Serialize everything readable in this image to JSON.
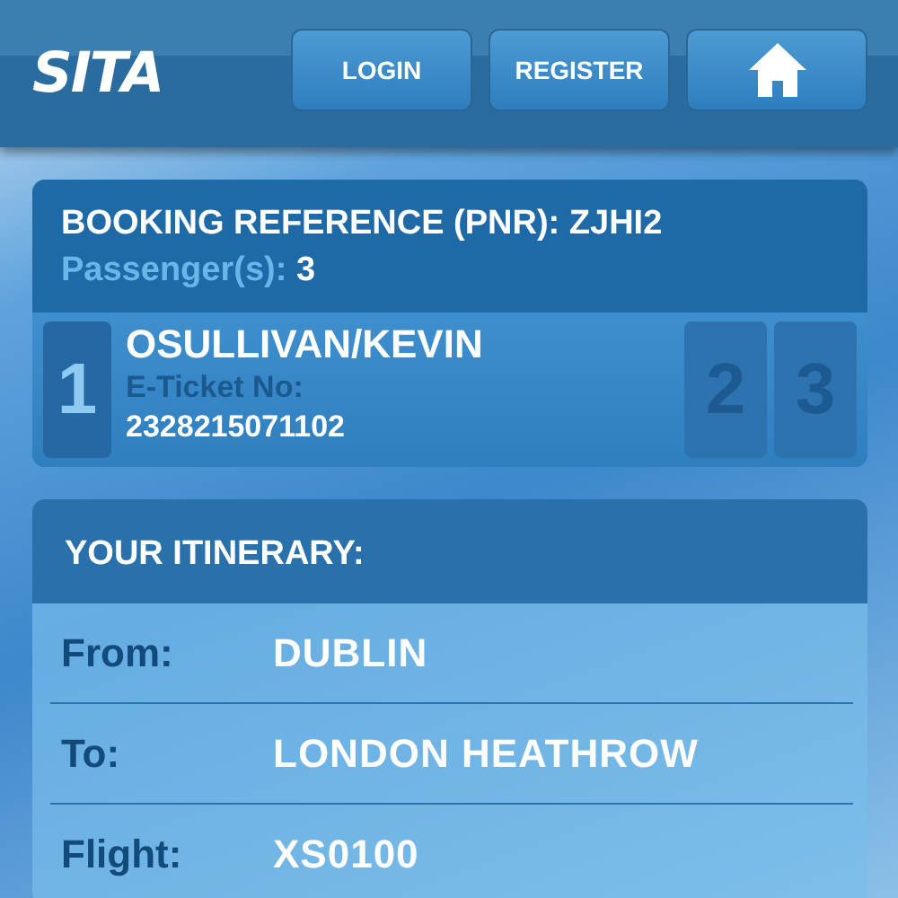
{
  "header": {
    "logo": "SITA",
    "buttons": [
      {
        "kind": "text",
        "label": "LOGIN"
      },
      {
        "kind": "text",
        "label": "REGISTER"
      },
      {
        "kind": "home"
      }
    ]
  },
  "booking": {
    "title": "BOOKING REFERENCE (PNR): ZJHI2",
    "passengers_label": "Passenger(s):",
    "passengers_count": "3",
    "passengers": [
      {
        "number": "1",
        "selected": true,
        "name": "OSULLIVAN/KEVIN",
        "ticket_label": "E-Ticket No:",
        "ticket_number": "2328215071102"
      },
      {
        "number": "2",
        "selected": false
      },
      {
        "number": "3",
        "selected": false
      }
    ]
  },
  "itinerary": {
    "title": "YOUR ITINERARY:",
    "rows": [
      {
        "label": "From:",
        "value": "DUBLIN"
      },
      {
        "label": "To:",
        "value": "LONDON HEATHROW"
      },
      {
        "label": "Flight:",
        "value": "XS0100"
      }
    ]
  }
}
